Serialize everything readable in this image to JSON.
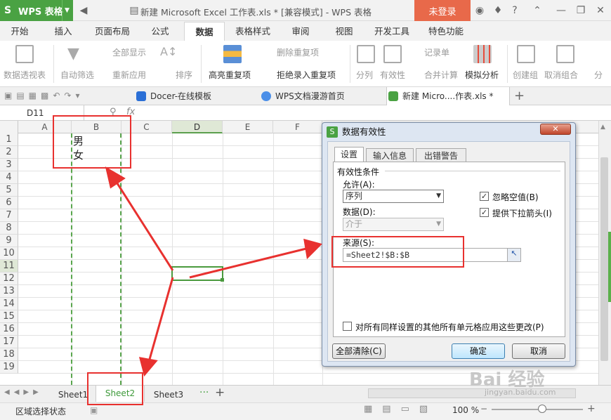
{
  "window": {
    "app_name": "WPS 表格",
    "doc_title": "新建 Microsoft Excel 工作表.xls * [兼容模式] - WPS 表格",
    "login_label": "未登录"
  },
  "ribbon_tabs": [
    "开始",
    "插入",
    "页面布局",
    "公式",
    "数据",
    "表格样式",
    "审阅",
    "视图",
    "开发工具",
    "特色功能"
  ],
  "ribbon": {
    "pivot": "数据透视表",
    "autofilter": "自动筛选",
    "show_all": "全部显示",
    "reapply": "重新应用",
    "sort": "排序",
    "highlight_dup": "高亮重复项",
    "remove_dup": "删除重复项",
    "reject_dup": "拒绝录入重复项",
    "split": "分列",
    "validity": "有效性",
    "record": "记录单",
    "consolidate": "合并计算",
    "whatif": "模拟分析",
    "group": "创建组",
    "ungroup": "取消组合",
    "subtotal": "分"
  },
  "doc_tabs": [
    "Docer-在线模板",
    "WPS文档漫游首页",
    "新建 Micro....作表.xls *"
  ],
  "formula_bar": {
    "name_box": "D11",
    "fx": "fx"
  },
  "columns": [
    "A",
    "B",
    "C",
    "D",
    "E",
    "F"
  ],
  "rows": [
    "1",
    "2",
    "3",
    "4",
    "5",
    "6",
    "7",
    "8",
    "9",
    "10",
    "11",
    "12",
    "13",
    "14",
    "15",
    "16",
    "17",
    "18",
    "19"
  ],
  "cells": {
    "B1": "男",
    "B2": "女"
  },
  "sheets": [
    "Sheet1",
    "Sheet2",
    "Sheet3"
  ],
  "status": {
    "mode": "区域选择状态",
    "zoom": "100 %"
  },
  "dialog": {
    "title": "数据有效性",
    "tabs": [
      "设置",
      "输入信息",
      "出错警告"
    ],
    "group_label": "有效性条件",
    "allow_label": "允许(A):",
    "allow_value": "序列",
    "ignore_blank": "忽略空值(B)",
    "dropdown": "提供下拉箭头(I)",
    "data_label": "数据(D):",
    "data_value": "介于",
    "source_label": "来源(S):",
    "source_value": "=Sheet2!$B:$B",
    "apply_all": "对所有同样设置的其他所有单元格应用这些更改(P)",
    "clear_all": "全部清除(C)",
    "ok": "确定",
    "cancel": "取消"
  },
  "watermark": {
    "brand": "Bai 经验",
    "url": "jingyan.baidu.com"
  }
}
